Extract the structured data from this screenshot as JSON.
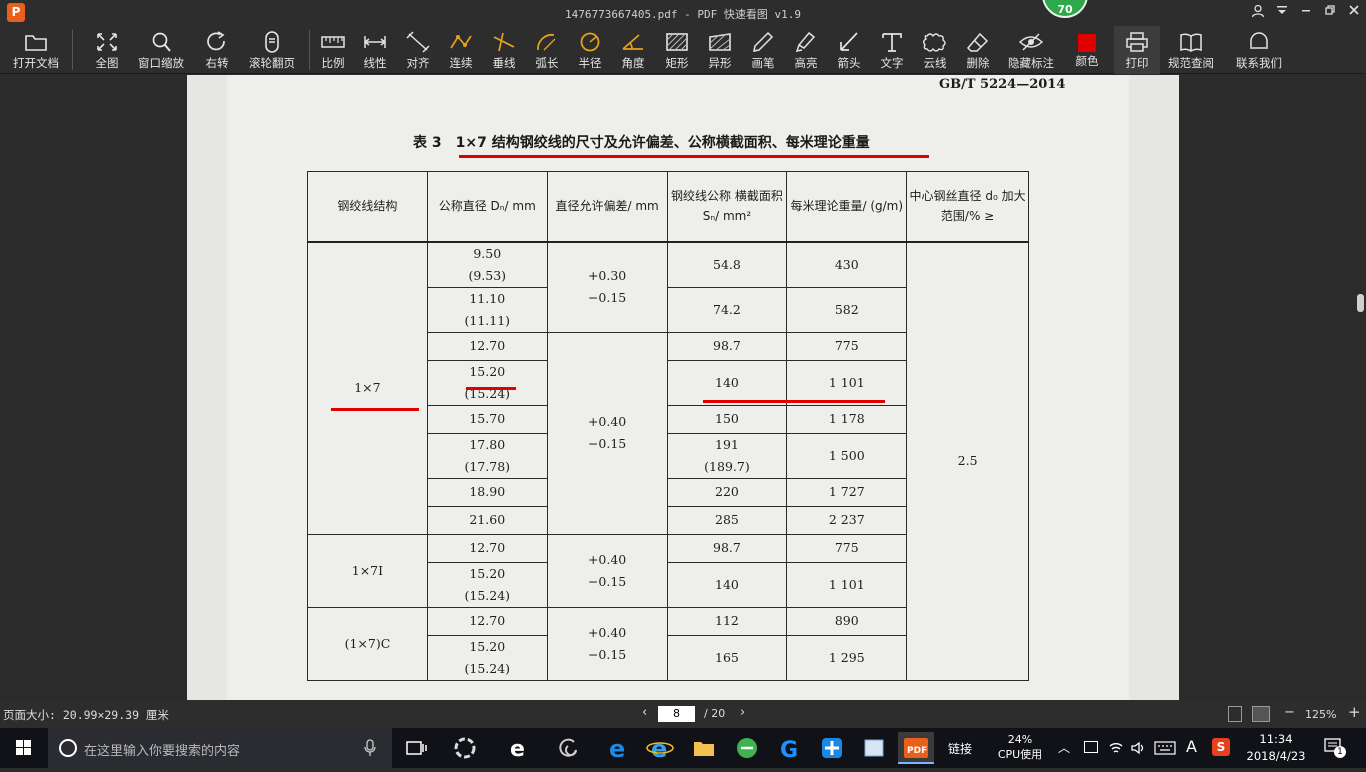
{
  "window": {
    "title": "1476773667405.pdf - PDF 快速看图 v1.9",
    "badge": "70",
    "logo": "P"
  },
  "toolbar": [
    {
      "label": "打开文档",
      "icon": "folder-icon"
    },
    {
      "label": "全图",
      "icon": "fit-page-icon"
    },
    {
      "label": "窗口缩放",
      "icon": "zoom-window-icon"
    },
    {
      "label": "右转",
      "icon": "rotate-right-icon"
    },
    {
      "label": "滚轮翻页",
      "icon": "mouse-scroll-icon"
    },
    {
      "label": "比例",
      "icon": "scale-ruler-icon"
    },
    {
      "label": "线性",
      "icon": "linear-measure-icon"
    },
    {
      "label": "对齐",
      "icon": "aligned-measure-icon"
    },
    {
      "label": "连续",
      "icon": "continuous-measure-icon"
    },
    {
      "label": "垂线",
      "icon": "perpendicular-icon"
    },
    {
      "label": "弧长",
      "icon": "arc-length-icon"
    },
    {
      "label": "半径",
      "icon": "radius-icon"
    },
    {
      "label": "角度",
      "icon": "angle-icon"
    },
    {
      "label": "矩形",
      "icon": "rectangle-area-icon"
    },
    {
      "label": "异形",
      "icon": "polygon-area-icon"
    },
    {
      "label": "画笔",
      "icon": "pen-icon"
    },
    {
      "label": "高亮",
      "icon": "highlighter-icon"
    },
    {
      "label": "箭头",
      "icon": "arrow-icon"
    },
    {
      "label": "文字",
      "icon": "text-icon"
    },
    {
      "label": "云线",
      "icon": "cloud-line-icon"
    },
    {
      "label": "删除",
      "icon": "eraser-icon"
    },
    {
      "label": "隐藏标注",
      "icon": "hide-markup-icon"
    },
    {
      "label": "颜色",
      "icon": "color-swatch-icon"
    },
    {
      "label": "打印",
      "icon": "printer-icon"
    },
    {
      "label": "规范查阅",
      "icon": "book-icon"
    },
    {
      "label": "联系我们",
      "icon": "support-icon"
    }
  ],
  "colors": {
    "accent_red": "#e00000",
    "swatch": "#e00000",
    "badge_green": "#2ea84a"
  },
  "document": {
    "header": "GB/T 5224—2014",
    "caption_num": "表 3",
    "caption_text": "1×7 结构钢绞线的尺寸及允许偏差、公称横截面积、每米理论重量",
    "columns": [
      "钢绞线结构",
      "公称直径 Dₙ/ mm",
      "直径允许偏差/ mm",
      "钢绞线公称 横截面积 Sₙ/ mm²",
      "每米理论重量/ (g/m)",
      "中心钢丝直径 d₀ 加大范围/% ≥"
    ],
    "groups": [
      {
        "structure": "1×7",
        "tolerances": [
          "+0.30\n−0.15",
          "+0.40\n−0.15"
        ],
        "center": "2.5",
        "rows": [
          {
            "d": "9.50\n(9.53)",
            "s": "54.8",
            "w": "430"
          },
          {
            "d": "11.10\n(11.11)",
            "s": "74.2",
            "w": "582"
          },
          {
            "d": "12.70",
            "s": "98.7",
            "w": "775"
          },
          {
            "d": "15.20\n(15.24)",
            "s": "140",
            "w": "1 101"
          },
          {
            "d": "15.70",
            "s": "150",
            "w": "1 178"
          },
          {
            "d": "17.80\n(17.78)",
            "s": "191\n(189.7)",
            "w": "1 500"
          },
          {
            "d": "18.90",
            "s": "220",
            "w": "1 727"
          },
          {
            "d": "21.60",
            "s": "285",
            "w": "2 237"
          }
        ]
      },
      {
        "structure": "1×7I",
        "tolerances": [
          "+0.40\n−0.15"
        ],
        "rows": [
          {
            "d": "12.70",
            "s": "98.7",
            "w": "775"
          },
          {
            "d": "15.20\n(15.24)",
            "s": "140",
            "w": "1 101"
          }
        ]
      },
      {
        "structure": "(1×7)C",
        "tolerances": [
          "+0.40\n−0.15"
        ],
        "rows": [
          {
            "d": "12.70",
            "s": "112",
            "w": "890"
          },
          {
            "d": "15.20\n(15.24)",
            "s": "165",
            "w": "1 295"
          }
        ]
      }
    ]
  },
  "status": {
    "page_size": "页面大小: 20.99×29.39 厘米",
    "current_page": "8",
    "total_pages": "/ 20",
    "zoom": "125%"
  },
  "taskbar": {
    "search_placeholder": "在这里输入你要搜索的内容",
    "link_label": "链接",
    "cpu_percent": "24%",
    "cpu_label": "CPU使用",
    "ime": "A",
    "time": "11:34",
    "date": "2018/4/23",
    "notifications": "1"
  }
}
